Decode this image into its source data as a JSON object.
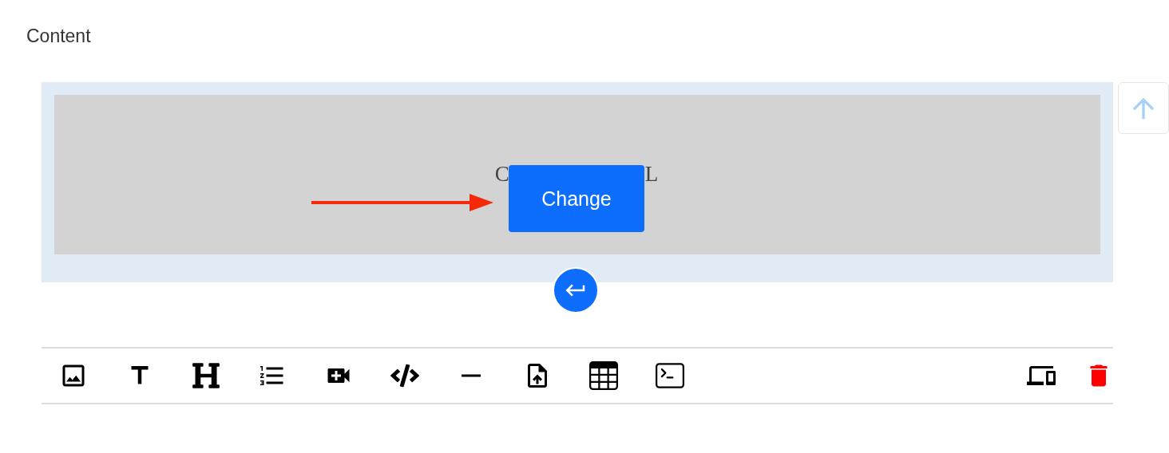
{
  "section": {
    "title": "Content"
  },
  "block": {
    "placeholder_parts": [
      "C",
      "L"
    ],
    "button": "Change"
  },
  "toolbar": {
    "tools": [
      {
        "kind": "image"
      },
      {
        "kind": "text"
      },
      {
        "kind": "heading"
      },
      {
        "kind": "list"
      },
      {
        "kind": "video"
      },
      {
        "kind": "code"
      },
      {
        "kind": "rule"
      },
      {
        "kind": "upload"
      },
      {
        "kind": "table"
      },
      {
        "kind": "terminal"
      }
    ],
    "actions": [
      {
        "kind": "devices"
      },
      {
        "kind": "delete"
      }
    ]
  }
}
